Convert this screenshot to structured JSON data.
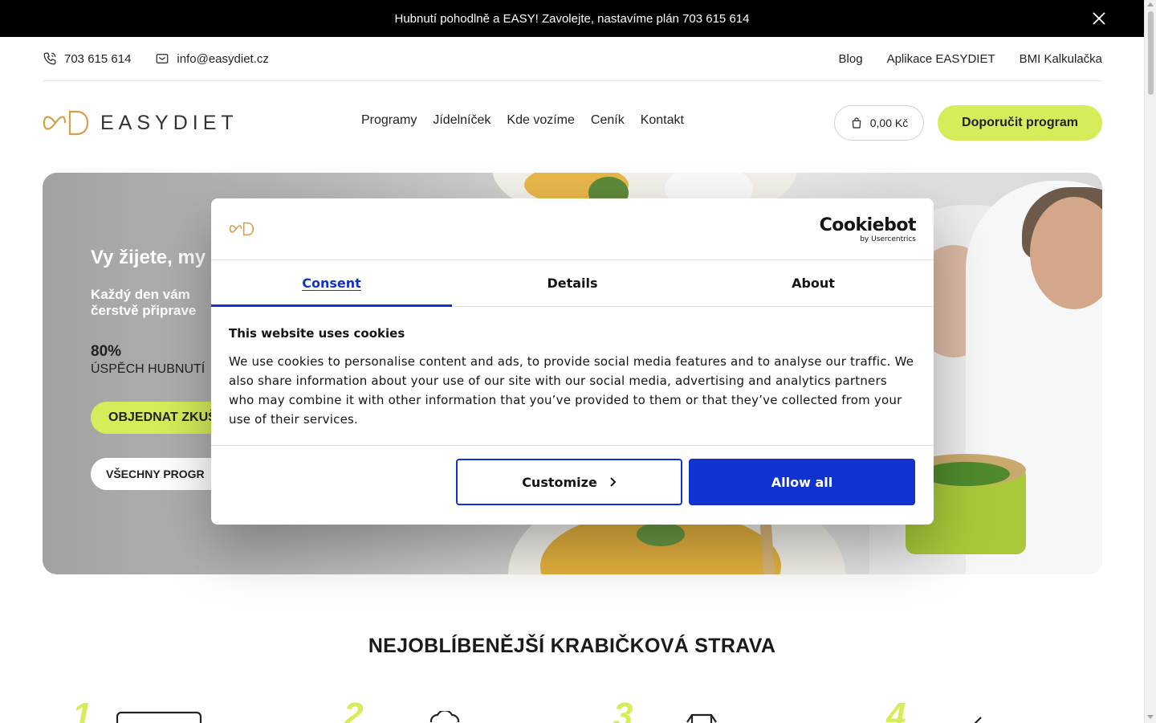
{
  "announcement": {
    "text": "Hubnutí pohodlně a EASY! Zavolejte, nastavíme plán 703 615 614",
    "close_icon": "close-icon"
  },
  "contact_bar": {
    "phone": "703 615 614",
    "email": "info@easydiet.cz",
    "links": [
      "Blog",
      "Aplikace EASYDIET",
      "BMI Kalkulačka"
    ]
  },
  "header": {
    "logo_text": "EASYDIET",
    "nav": [
      "Programy",
      "Jídelníček",
      "Kde vozíme",
      "Ceník",
      "Kontakt"
    ],
    "cart_value": "0,00 Kč",
    "cta_label": "Doporučit program"
  },
  "hero": {
    "title": "Vy žijete, my",
    "subtitle_line1": "Každý den vám",
    "subtitle_line2": "čerstvě připrave",
    "stat_value": "80%",
    "stat_label": "ÚSPĚCH HUBNUTÍ",
    "primary_button": "OBJEDNAT ZKUŠ",
    "secondary_button": "VŠECHNY PROGR"
  },
  "section": {
    "title": "NEJOBLÍBENĚJŠÍ KRABIČKOVÁ STRAVA",
    "steps": [
      "1",
      "2",
      "3",
      "4"
    ]
  },
  "cookie_modal": {
    "brand": "Cookiebot",
    "brand_sub": "by Usercentrics",
    "tabs": [
      "Consent",
      "Details",
      "About"
    ],
    "active_tab": "Consent",
    "heading": "This website uses cookies",
    "body": "We use cookies to personalise content and ads, to provide social media features and to analyse our traffic. We also share information about your use of our site with our social media, advertising and analytics partners who may combine it with other information that you’ve provided to them or that they’ve collected from your use of their services.",
    "customize_label": "Customize",
    "allow_label": "Allow all"
  },
  "colors": {
    "accent_lime": "#d7ec5a",
    "cookiebot_blue": "#1032cf",
    "logo_gold": "#d4a04a"
  }
}
